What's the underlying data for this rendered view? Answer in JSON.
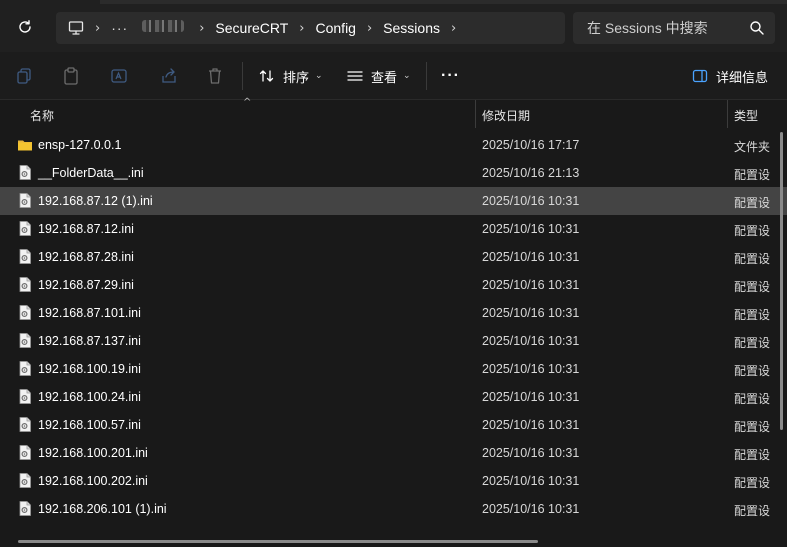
{
  "breadcrumb": {
    "overflow": "···",
    "items": [
      "SecureCRT",
      "Config",
      "Sessions"
    ]
  },
  "search": {
    "placeholder": "在 Sessions 中搜索"
  },
  "toolbar": {
    "sort_label": "排序",
    "view_label": "查看",
    "more_label": "···",
    "details_label": "详细信息"
  },
  "columns": {
    "name": "名称",
    "modified": "修改日期",
    "type": "类型"
  },
  "files": [
    {
      "name": "ensp-127.0.0.1",
      "modified": "2025/10/16 17:17",
      "type": "文件夹",
      "icon": "folder-icon"
    },
    {
      "name": "__FolderData__.ini",
      "modified": "2025/10/16 21:13",
      "type": "配置设",
      "icon": "ini-file-icon"
    },
    {
      "name": "192.168.87.12 (1).ini",
      "modified": "2025/10/16 10:31",
      "type": "配置设",
      "icon": "ini-file-icon",
      "selected": true
    },
    {
      "name": "192.168.87.12.ini",
      "modified": "2025/10/16 10:31",
      "type": "配置设",
      "icon": "ini-file-icon"
    },
    {
      "name": "192.168.87.28.ini",
      "modified": "2025/10/16 10:31",
      "type": "配置设",
      "icon": "ini-file-icon"
    },
    {
      "name": "192.168.87.29.ini",
      "modified": "2025/10/16 10:31",
      "type": "配置设",
      "icon": "ini-file-icon"
    },
    {
      "name": "192.168.87.101.ini",
      "modified": "2025/10/16 10:31",
      "type": "配置设",
      "icon": "ini-file-icon"
    },
    {
      "name": "192.168.87.137.ini",
      "modified": "2025/10/16 10:31",
      "type": "配置设",
      "icon": "ini-file-icon"
    },
    {
      "name": "192.168.100.19.ini",
      "modified": "2025/10/16 10:31",
      "type": "配置设",
      "icon": "ini-file-icon"
    },
    {
      "name": "192.168.100.24.ini",
      "modified": "2025/10/16 10:31",
      "type": "配置设",
      "icon": "ini-file-icon"
    },
    {
      "name": "192.168.100.57.ini",
      "modified": "2025/10/16 10:31",
      "type": "配置设",
      "icon": "ini-file-icon"
    },
    {
      "name": "192.168.100.201.ini",
      "modified": "2025/10/16 10:31",
      "type": "配置设",
      "icon": "ini-file-icon"
    },
    {
      "name": "192.168.100.202.ini",
      "modified": "2025/10/16 10:31",
      "type": "配置设",
      "icon": "ini-file-icon"
    },
    {
      "name": "192.168.206.101 (1).ini",
      "modified": "2025/10/16 10:31",
      "type": "配置设",
      "icon": "ini-file-icon"
    }
  ],
  "colors": {
    "background": "#191919",
    "selected_row": "#444444",
    "folder": "#f4c430",
    "accent": "#4aa3ff"
  }
}
